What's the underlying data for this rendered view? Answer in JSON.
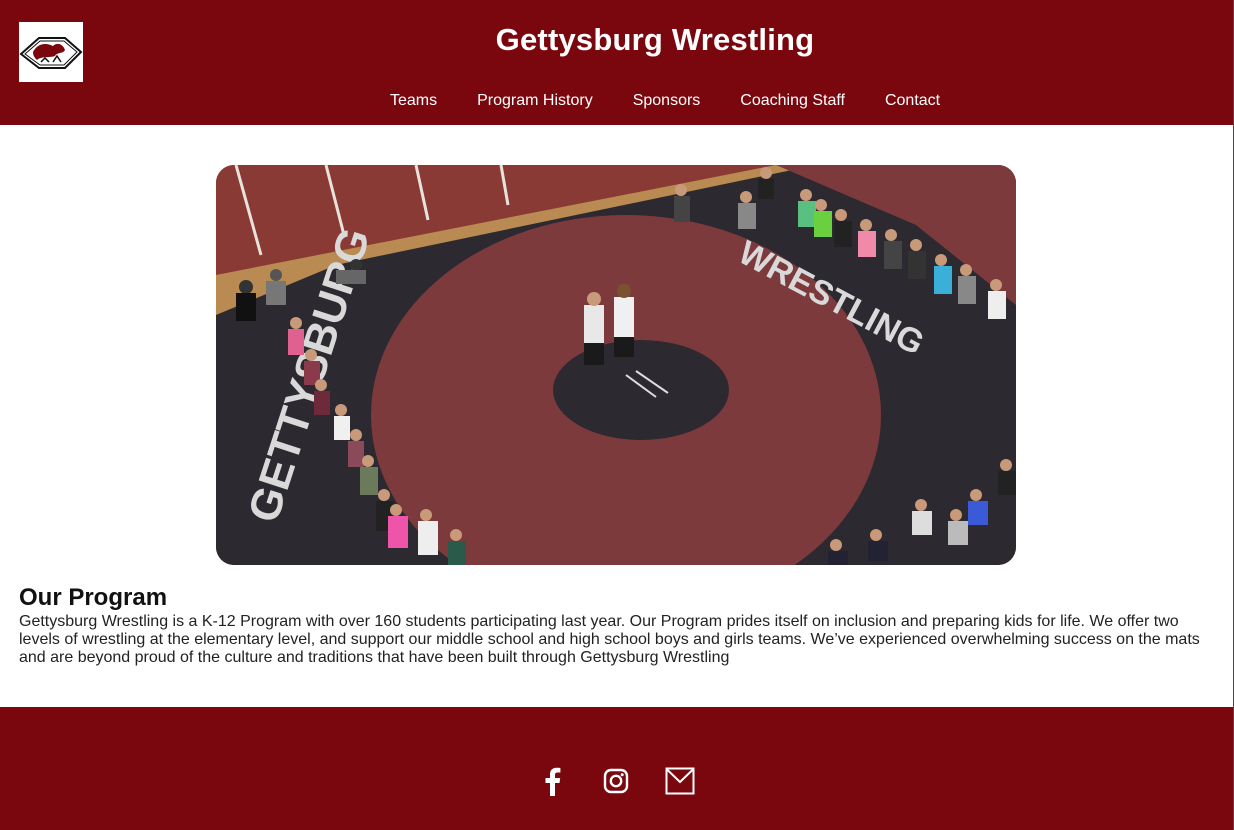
{
  "site": {
    "title": "Gettysburg Wrestling",
    "logo_icon": "arrowhead-warrior-logo-icon"
  },
  "nav": {
    "items": [
      {
        "label": "Teams"
      },
      {
        "label": "Program History"
      },
      {
        "label": "Sponsors"
      },
      {
        "label": "Coaching Staff"
      },
      {
        "label": "Contact"
      }
    ]
  },
  "hero": {
    "mat_text_left": "GETTYSBURG",
    "mat_text_right": "WRESTLING"
  },
  "program": {
    "heading": "Our Program",
    "body": "Gettysburg Wrestling is a K-12 Program with over 160 students participating last year. Our Program prides itself on inclusion and preparing kids for life. We offer two levels of wrestling at the elementary level, and support our middle school and high school boys and girls teams. We’ve experienced overwhelming success on the mats and are beyond proud of the culture and traditions that have been built through Gettysburg Wrestling"
  },
  "footer": {
    "social": [
      {
        "icon": "facebook-icon"
      },
      {
        "icon": "instagram-icon"
      },
      {
        "icon": "email-icon"
      }
    ]
  },
  "colors": {
    "brand": "#7a070e",
    "mat_red": "#7d3a3c",
    "mat_dark": "#2c2a30",
    "text": "#ffffff"
  }
}
